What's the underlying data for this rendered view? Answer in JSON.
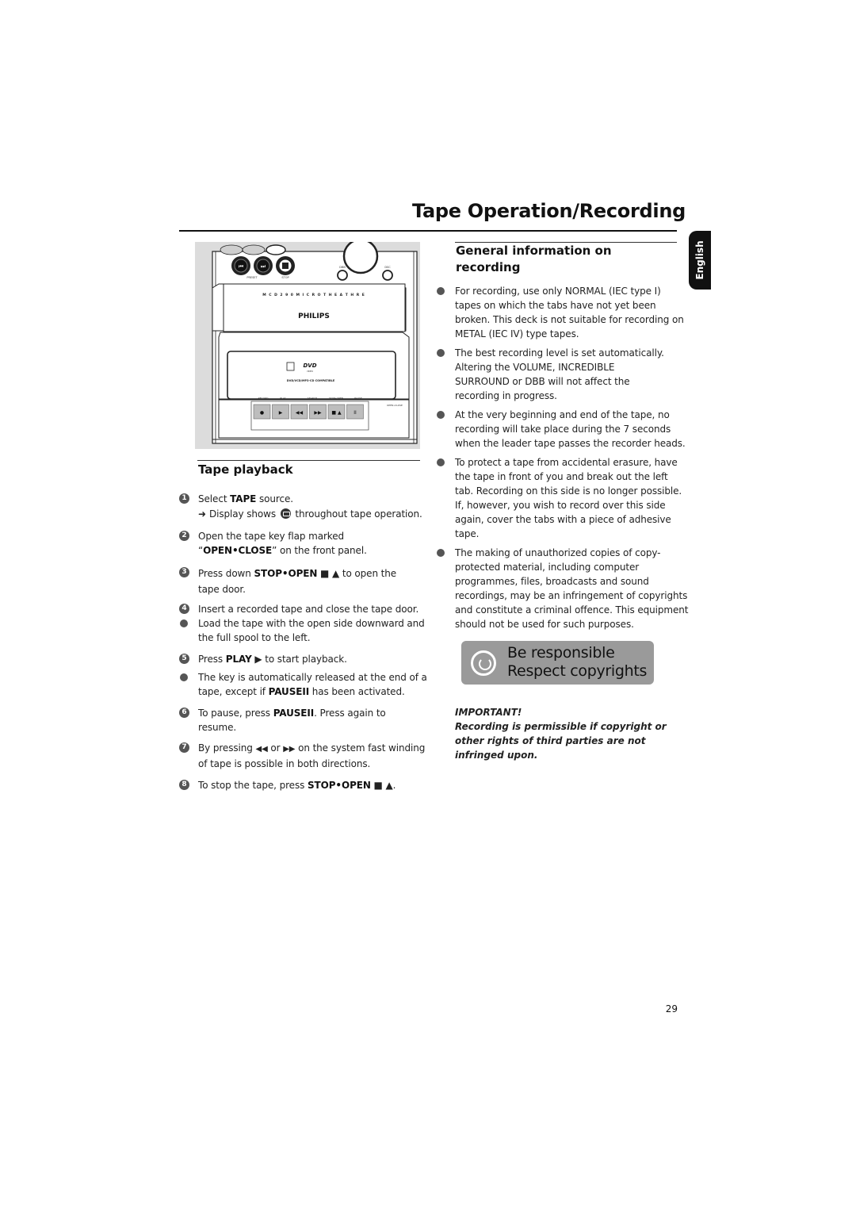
{
  "page": {
    "title": "Tape Operation/Recording",
    "language_tab": "English",
    "page_number": "29"
  },
  "illustration": {
    "model_label": "M C D 2 9 0   M I C R O   T H E A T H R E",
    "brand": "PHILIPS",
    "dvd_logo": "DVD",
    "dvd_sub": "VIDEO",
    "compat_label": "DVD/VCD/MP3-CD COMPATIBLE",
    "top_labels": [
      "PRESET",
      "STOP",
      "DBB",
      "DSC"
    ],
    "deck_labels": [
      "RECORD",
      "PLAY",
      "SEARCH",
      "STOP•OPEN",
      "PAUSE"
    ],
    "open_close_label": "OPEN•CLOSE",
    "deck_buttons": [
      "●",
      "▶",
      "◀◀",
      "▶▶",
      "■ ▲",
      "II"
    ]
  },
  "tape_playback": {
    "heading": "Tape playback",
    "steps": [
      {
        "marker": "1",
        "type": "step",
        "parts": {
          "a": "Select ",
          "b": "TAPE",
          "c": " source."
        }
      },
      {
        "type": "result",
        "arrow": "➜",
        "pre": "Display shows",
        "post": "throughout tape operation."
      },
      {
        "marker": "2",
        "type": "step",
        "line1": "Open the tape key flap marked",
        "q_open": "“",
        "bold": "OPEN•CLOSE",
        "q_close": "”",
        "rest": " on the front panel."
      },
      {
        "marker": "3",
        "type": "step",
        "pre": "Press down ",
        "bold": "STOP•OPEN",
        "sym": " ■ ▲",
        "post": " to open the",
        "line2": "tape door."
      },
      {
        "marker": "4",
        "type": "step",
        "text": "Insert a recorded tape and close the tape door."
      },
      {
        "type": "bullet",
        "line1": "Load the tape with the open side downward and",
        "line2": "the full spool to the left."
      },
      {
        "marker": "5",
        "type": "step",
        "pre": "Press ",
        "bold": "PLAY",
        "sym": " ▶",
        "post": " to start playback."
      },
      {
        "type": "bullet",
        "line1": "The key is automatically released at the end of a",
        "pre": "tape, except if ",
        "bold": "PAUSEII",
        "post": " has been activated."
      },
      {
        "marker": "6",
        "type": "step",
        "pre": "To pause, press ",
        "bold": "PAUSEII",
        "post": ". Press again to",
        "line2": "resume."
      },
      {
        "marker": "7",
        "type": "step",
        "pre": "By pressing ",
        "sym1": "◀◀",
        "mid": " or ",
        "sym2": "▶▶",
        "post": " on the system fast winding",
        "line2": "of tape is possible in both directions."
      },
      {
        "marker": "8",
        "type": "step",
        "pre": "To stop the tape, press ",
        "bold": "STOP•OPEN",
        "sym": " ■ ▲",
        "post": "."
      }
    ]
  },
  "general_recording": {
    "heading_line1": "General information on",
    "heading_line2": "recording",
    "bullets": [
      [
        "For recording, use only NORMAL (IEC type I)",
        "tapes on which the tabs have not yet been",
        "broken. This deck is not suitable for recording on",
        "METAL (IEC IV) type tapes."
      ],
      [
        "The best recording level is set automatically.",
        "Altering the VOLUME, INCREDIBLE",
        "SURROUND or DBB will not affect the",
        "recording in progress."
      ],
      [
        "At the very beginning and end of the tape, no",
        "recording will take place during the 7 seconds",
        "when the leader tape passes the recorder heads."
      ],
      [
        "To protect a tape from accidental erasure, have",
        "the tape in front of you and break out the left",
        "tab. Recording on this side is no longer possible.",
        "If, however, you wish to record over this side",
        "again, cover the tabs with a piece of adhesive",
        "tape."
      ],
      [
        "The making of unauthorized copies of copy-",
        "protected material, including computer",
        "programmes, files, broadcasts and sound",
        "recordings, may be an infringement of copyrights",
        "and constitute a criminal offence. This equipment",
        "should not be used for such purposes."
      ]
    ]
  },
  "badge": {
    "line1": "Be responsible",
    "line2": "Respect copyrights"
  },
  "important": {
    "label": "IMPORTANT!",
    "lines": [
      "Recording is permissible if copyright or",
      "other rights of third parties are not",
      "infringed upon."
    ]
  }
}
